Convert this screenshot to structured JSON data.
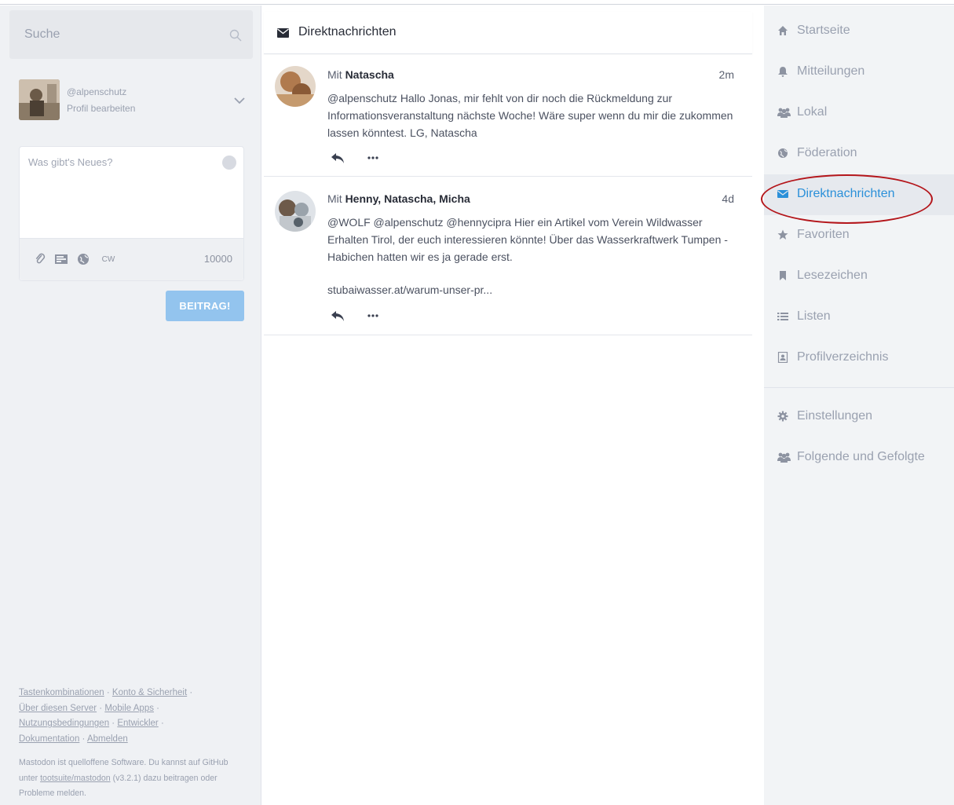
{
  "search": {
    "placeholder": "Suche"
  },
  "account": {
    "handle": "@alpenschutz",
    "edit_label": "Profil bearbeiten"
  },
  "compose": {
    "placeholder": "Was gibt's Neues?",
    "cw_label": "CW",
    "char_count": "10000",
    "submit_label": "BEITRAG!"
  },
  "footer": {
    "links": [
      "Tastenkombinationen",
      "Konto & Sicherheit",
      "Über diesen Server",
      "Mobile Apps",
      "Nutzungsbedingungen",
      "Entwickler",
      "Dokumentation",
      "Abmelden"
    ],
    "about_pre": "Mastodon ist quelloffene Software. Du kannst auf GitHub unter",
    "about_link": "tootsuite/mastodon",
    "about_version": "(v3.2.1)",
    "about_post": "dazu beitragen oder Probleme melden."
  },
  "column": {
    "title": "Direktnachrichten",
    "icon": "envelope-icon"
  },
  "conversations": [
    {
      "prefix": "Mit",
      "participants": "Natascha",
      "time": "2m",
      "text": "@alpenschutz Hallo Jonas, mir fehlt von dir noch die Rückmeldung zur Informationsveranstaltung nächste Woche! Wäre super wenn du mir die zukommen lassen könntest. LG, Natascha"
    },
    {
      "prefix": "Mit",
      "participants": "Henny, Natascha, Micha",
      "time": "4d",
      "text": "@WOLF @alpenschutz @hennycipra Hier ein Artikel vom Verein Wildwasser Erhalten Tirol, der euch interessieren könnte! Über das Wasserkraftwerk Tumpen -Habichen hatten wir es ja gerade erst.",
      "link": "stubaiwasser.at/warum-unser-pr..."
    }
  ],
  "nav": {
    "items": [
      {
        "label": "Startseite",
        "icon": "home-icon"
      },
      {
        "label": "Mitteilungen",
        "icon": "bell-icon"
      },
      {
        "label": "Lokal",
        "icon": "users-icon"
      },
      {
        "label": "Föderation",
        "icon": "globe-icon"
      },
      {
        "label": "Direktnachrichten",
        "icon": "envelope-icon",
        "active": true
      },
      {
        "label": "Favoriten",
        "icon": "star-icon"
      },
      {
        "label": "Lesezeichen",
        "icon": "bookmark-icon"
      },
      {
        "label": "Listen",
        "icon": "list-icon"
      },
      {
        "label": "Profilverzeichnis",
        "icon": "address-book-icon"
      }
    ],
    "secondary": [
      {
        "label": "Einstellungen",
        "icon": "gear-icon"
      },
      {
        "label": "Folgende und Gefolgte",
        "icon": "users-icon"
      }
    ]
  },
  "colors": {
    "accent": "#2b90d9",
    "button": "#93c4ee",
    "highlight": "#b4161b"
  }
}
